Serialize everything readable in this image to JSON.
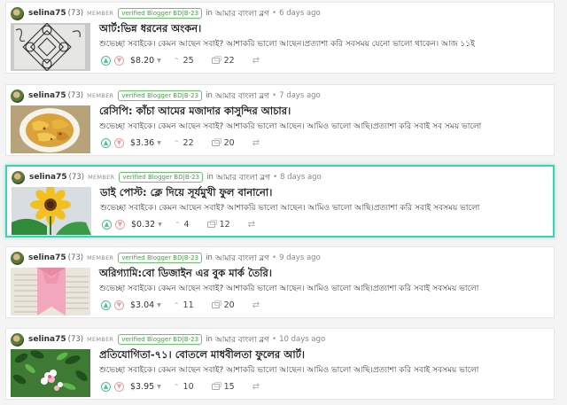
{
  "posts": [
    {
      "author": "selina75",
      "reputation": "(73)",
      "role": "MEMBER",
      "tag": "verified Blogger BD|B-23",
      "in_label": "in",
      "community": "আমার বাংলা ব্লগ",
      "separator": "•",
      "time": "6 days ago",
      "title": "আর্ট:ভিন্ন ধরনের অংকন।",
      "excerpt": "শুভেচ্ছা সবাইকে। কেমন আছেন সবাই? আশাকরি ভালো আছেন।প্রত্যাশা করি সবসময় যেনো ভালো থাকেন। আজ ১১ই",
      "payout": "$8.20",
      "votes": "25",
      "comments": "22",
      "highlighted": false
    },
    {
      "author": "selina75",
      "reputation": "(73)",
      "role": "MEMBER",
      "tag": "verified Blogger BD|B-23",
      "in_label": "in",
      "community": "আমার বাংলা ব্লগ",
      "separator": "•",
      "time": "7 days ago",
      "title": "রেসিপি: কাঁচা আমের মজাদার কাসুন্দির আচার।",
      "excerpt": "শুভেচ্ছা সবাইকে। কেমন আছেন সবাই? আশাকরি ভালো আছেন। আমিও ভালো আছি।প্রত্যাশা করি সবাই সব সময় ভালো",
      "payout": "$3.36",
      "votes": "22",
      "comments": "20",
      "highlighted": false
    },
    {
      "author": "selina75",
      "reputation": "(73)",
      "role": "MEMBER",
      "tag": "verified Blogger BD|B-23",
      "in_label": "in",
      "community": "আমার বাংলা ব্লগ",
      "separator": "•",
      "time": "8 days ago",
      "title": "ডাই পোস্ট: ক্লে দিয়ে সূর্যমুখী ফুল বানানো।",
      "excerpt": "শুভেচ্ছা সবাইকে। কেমন আছেন সবাই? আশাকরি ভালো আছেন। আমিও ভালো আছি।প্রত্যাশা করি সবাই সবসময় ভালো",
      "payout": "$0.32",
      "votes": "4",
      "comments": "12",
      "highlighted": true
    },
    {
      "author": "selina75",
      "reputation": "(73)",
      "role": "MEMBER",
      "tag": "verified Blogger BD|B-23",
      "in_label": "in",
      "community": "আমার বাংলা ব্লগ",
      "separator": "•",
      "time": "9 days ago",
      "title": "অরিগ্যামি:বো ডিজাইন এর বুক মার্ক তৈরি।",
      "excerpt": "শুভেচ্ছা সবাইকে। কেমন আছেন সবাই? আশাকরি ভালো আছেন। আমিও ভালো আছি।প্রত্যাশা করি সবাই সবসময় ভালো",
      "payout": "$3.04",
      "votes": "11",
      "comments": "20",
      "highlighted": false
    },
    {
      "author": "selina75",
      "reputation": "(73)",
      "role": "MEMBER",
      "tag": "verified Blogger BD|B-23",
      "in_label": "in",
      "community": "আমার বাংলা ব্লগ",
      "separator": "•",
      "time": "10 days ago",
      "title": "প্রতিযোগিতা-৭১। বোতলে মাধবীলতা ফুলের আর্ট।",
      "excerpt": "শুভেচ্ছা সবাইকে। কেমন আছেন সবাই? আশাকরি ভালো আছেন। আমিও ভালো আছি।প্রত্যাশা করি সবাই সবসময় ভালো",
      "payout": "$3.95",
      "votes": "10",
      "comments": "15",
      "highlighted": false
    }
  ],
  "icons": {
    "upvote": "chevron-up-icon",
    "downvote": "chevron-down-icon",
    "votes": "upvote-count-icon",
    "comments": "comments-icon",
    "resteem": "resteem-icon"
  },
  "colors": {
    "highlight_border": "#3fd1b5",
    "upvote": "#4fc08d",
    "downvote": "#e9a0a0",
    "tag_border": "#68c36a"
  }
}
